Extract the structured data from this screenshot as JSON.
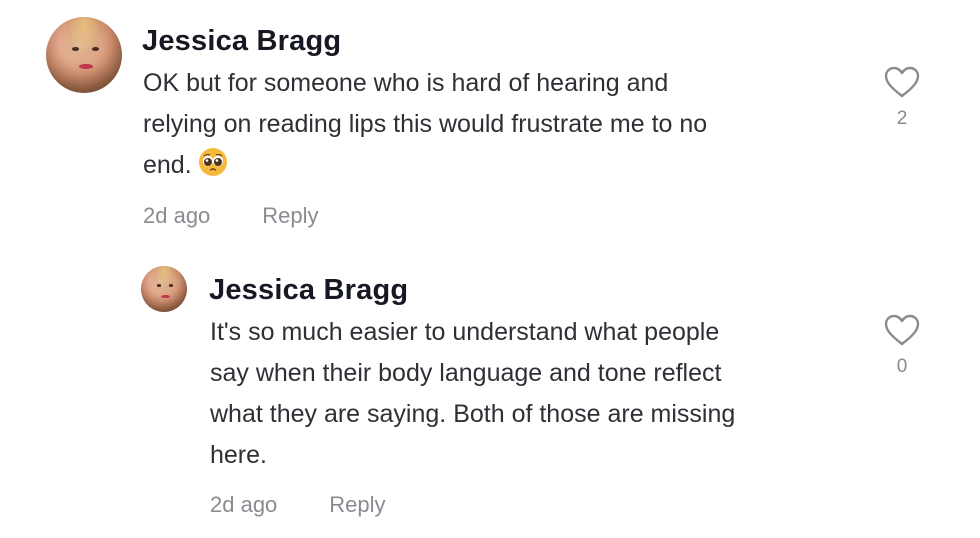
{
  "comments": [
    {
      "username": "Jessica Bragg",
      "text_lines": [
        "OK but for someone who is hard of hearing and",
        "relying on reading lips this would frustrate me to no",
        "end."
      ],
      "emoji": "pleading-face",
      "time": "2d ago",
      "reply_label": "Reply",
      "like_count": "2",
      "like_icon": "heart-icon"
    },
    {
      "username": "Jessica Bragg",
      "text_lines": [
        "It's so much easier to understand what people",
        "say when their body language and tone reflect",
        "what they are saying. Both of those are missing",
        "here."
      ],
      "time": "2d ago",
      "reply_label": "Reply",
      "like_count": "0",
      "like_icon": "heart-icon"
    }
  ],
  "colors": {
    "text": "#161823",
    "body_text": "#2f3036",
    "muted": "#8a8b91"
  }
}
